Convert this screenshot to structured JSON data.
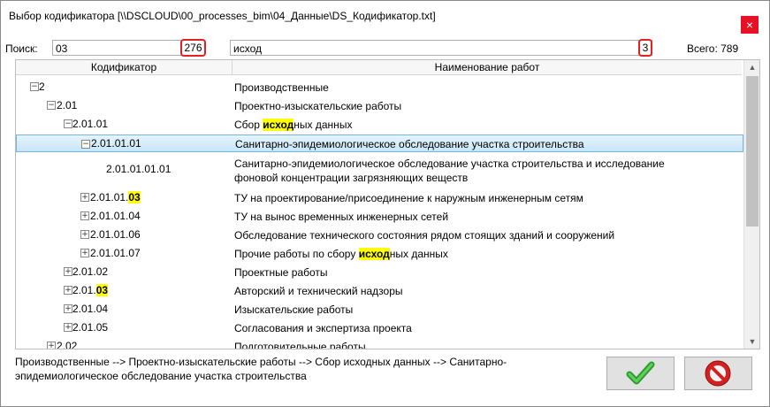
{
  "window": {
    "title": "Выбор кодификатора [\\\\DSCLOUD\\00_processes_bim\\04_Данные\\DS_Кодификатор.txt]",
    "close_glyph": "×"
  },
  "search": {
    "label": "Поиск:",
    "code_value": "03",
    "code_count": "276",
    "name_value": "исход",
    "name_count": "3",
    "total_label": "Всего: 789"
  },
  "grid": {
    "columns": [
      "Кодификатор",
      "Наименование работ"
    ],
    "rows": [
      {
        "code": "2",
        "code_hl": "",
        "name_pre": "Производственные",
        "name_hl": "",
        "name_post": "",
        "toggle": "⊟"
      },
      {
        "code": "2.01",
        "code_hl": "",
        "name_pre": "Проектно-изыскательские работы",
        "name_hl": "",
        "name_post": "",
        "toggle": "⊟"
      },
      {
        "code": "2.01.01",
        "code_hl": "",
        "name_pre": "Сбор ",
        "name_hl": "исход",
        "name_post": "ных данных",
        "toggle": "⊟"
      },
      {
        "code": "2.01.01.01",
        "code_hl": "",
        "name_pre": "Санитарно-эпидемиологическое обследование участка строительства",
        "name_hl": "",
        "name_post": "",
        "toggle": "⊟"
      },
      {
        "code": "2.01.01.01.01",
        "code_hl": "",
        "name_pre": "Санитарно-эпидемиологическое обследование участка строительства и исследование фоновой концентрации загрязняющих веществ",
        "name_hl": "",
        "name_post": "",
        "toggle": ""
      },
      {
        "code": "2.01.01.",
        "code_hl": "03",
        "name_pre": "ТУ на проектирование/присоединение к наружным инженерным сетям",
        "name_hl": "",
        "name_post": "",
        "toggle": "⊞"
      },
      {
        "code": "2.01.01.04",
        "code_hl": "",
        "name_pre": "ТУ на вынос временных инженерных сетей",
        "name_hl": "",
        "name_post": "",
        "toggle": "⊞"
      },
      {
        "code": "2.01.01.06",
        "code_hl": "",
        "name_pre": "Обследование технического состояния рядом стоящих зданий и сооружений",
        "name_hl": "",
        "name_post": "",
        "toggle": "⊞"
      },
      {
        "code": "2.01.01.07",
        "code_hl": "",
        "name_pre": "Прочие работы по сбору ",
        "name_hl": "исход",
        "name_post": "ных данных",
        "toggle": "⊞"
      },
      {
        "code": "2.01.02",
        "code_hl": "",
        "name_pre": "Проектные работы",
        "name_hl": "",
        "name_post": "",
        "toggle": "⊞"
      },
      {
        "code": "2.01.",
        "code_hl": "03",
        "name_pre": "Авторский и технический надзоры",
        "name_hl": "",
        "name_post": "",
        "toggle": "⊞"
      },
      {
        "code": "2.01.04",
        "code_hl": "",
        "name_pre": "Изыскательские работы",
        "name_hl": "",
        "name_post": "",
        "toggle": "⊞"
      },
      {
        "code": "2.01.05",
        "code_hl": "",
        "name_pre": "Согласования и экспертиза проекта",
        "name_hl": "",
        "name_post": "",
        "toggle": "⊞"
      },
      {
        "code": "2.02",
        "code_hl": "",
        "name_pre": "Подготовительные работы",
        "name_hl": "",
        "name_post": "",
        "toggle": "⊞"
      }
    ]
  },
  "status_path": "Производственные  --> Проектно-изыскательские работы --> Сбор исходных данных --> Санитарно-эпидемиологическое обследование участка строительства",
  "buttons": {
    "ok_icon": "checkmark-icon",
    "cancel_icon": "no-entry-icon"
  },
  "colors": {
    "highlight": "#ffff00",
    "selected_row": "#cce8f8",
    "count_border": "#e32121",
    "close": "#e81123",
    "ok_green": "#3db33d",
    "cancel_red": "#d42020"
  }
}
